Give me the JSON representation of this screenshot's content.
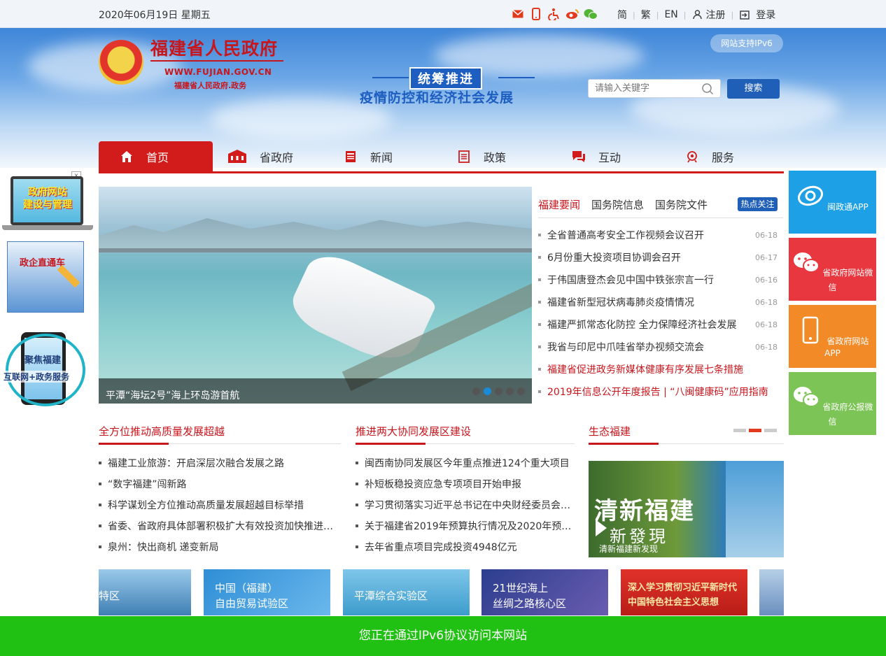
{
  "topbar": {
    "date": "2020年06月19日  星期五",
    "icons": [
      "mail-icon",
      "mobile-icon",
      "accessibility-icon",
      "weibo-icon",
      "wechat-icon"
    ],
    "links": {
      "simplified": "简",
      "traditional": "繁",
      "english": "EN",
      "register": "注册",
      "login": "登录"
    }
  },
  "header": {
    "title": "福建省人民政府",
    "url": "WWW.FUJIAN.GOV.CN",
    "subtitle": "福建省人民政府.政务",
    "slogan_top": "统筹推进",
    "slogan_bottom": "疫情防控和经济社会发展",
    "ipv6_badge": "网站支持IPv6",
    "search_placeholder": "请输入关键字",
    "search_button": "搜索"
  },
  "nav": [
    {
      "label": "首页",
      "icon": "home-icon"
    },
    {
      "label": "省政府",
      "icon": "building-icon"
    },
    {
      "label": "新闻",
      "icon": "newspaper-icon"
    },
    {
      "label": "政策",
      "icon": "document-icon"
    },
    {
      "label": "互动",
      "icon": "chat-icon"
    },
    {
      "label": "服务",
      "icon": "service-icon"
    }
  ],
  "left_floats": {
    "gov_site": "政府网站\n建设与管理",
    "direct_train": "政企直通车",
    "focus_fujian": "聚焦福建",
    "internet_service": "互联网+政务服务"
  },
  "right_floats": [
    {
      "label": "闽政通APP",
      "color": "#1ea0e6",
      "icon": "minzhengtong-icon"
    },
    {
      "label": "省政府网站微信",
      "color": "#e8373e",
      "icon": "wechat-icon"
    },
    {
      "label": "省政府网站APP",
      "color": "#f28a27",
      "icon": "mobile-app-icon"
    },
    {
      "label": "省政府公报微信",
      "color": "#7cc455",
      "icon": "wechat-icon"
    }
  ],
  "banner": {
    "caption": "平潭“海坛2号”海上环岛游首航",
    "dots": 5,
    "active_dot": 1
  },
  "news": {
    "tabs": [
      "福建要闻",
      "国务院信息",
      "国务院文件"
    ],
    "active_tab": 0,
    "hot_label": "热点关注",
    "items": [
      {
        "title": "全省普通高考安全工作视频会议召开",
        "date": "06-18"
      },
      {
        "title": "6月份重大投资项目协调会召开",
        "date": "06-17"
      },
      {
        "title": "于伟国唐登杰会见中国中铁张宗言一行",
        "date": "06-16"
      },
      {
        "title": "福建省新型冠状病毒肺炎疫情情况",
        "date": "06-18"
      },
      {
        "title": "福建严抓常态化防控 全力保障经济社会发展",
        "date": "06-18"
      },
      {
        "title": "我省与印尼中爪哇省举办视频交流会",
        "date": "06-18"
      },
      {
        "title": "福建省促进政务新媒体健康有序发展七条措施",
        "date": ""
      },
      {
        "title": "2019年信息公开年度报告 | “八闽健康码”应用指南",
        "date": ""
      }
    ]
  },
  "columns": [
    {
      "title": "全方位推动高质量发展超越",
      "items": [
        "福建工业旅游：开启深层次融合发展之路",
        "“数字福建”闯新路",
        "科学谋划全方位推动高质量发展超越目标举措",
        "省委、省政府具体部署积极扩大有效投资加快推进…",
        "泉州：快出商机 递变新局"
      ]
    },
    {
      "title": "推进两大协同发展区建设",
      "items": [
        "闽西南协同发展区今年重点推进124个重大项目",
        "补短板稳投资应急专项项目开始申报",
        "学习贯彻落实习近平总书记在中央财经委员会…",
        "关于福建省2019年预算执行情况及2020年预算…",
        "去年省重点项目完成投资4948亿元"
      ]
    },
    {
      "title": "生态福建",
      "image_text": "清新福建",
      "image_sub": "新發現",
      "caption": "清新福建新发现"
    }
  ],
  "tiles": [
    {
      "label": "特区",
      "color": "#5a9fd6"
    },
    {
      "label": "中国（福建）\n自由贸易试验区",
      "color": "#2f8ed6"
    },
    {
      "label": "平潭综合实验区",
      "color": "#46a5d8"
    },
    {
      "label": "21世纪海上\n丝绸之路核心区",
      "color": "#3d4f9e"
    },
    {
      "label": "深入学习贯彻习近平新时代\n中国特色社会主义思想",
      "color": "#d02a20"
    },
    {
      "label": "",
      "color": "#6a8fbf"
    }
  ],
  "ipv6_notice": "您正在通过IPv6协议访问本网站"
}
